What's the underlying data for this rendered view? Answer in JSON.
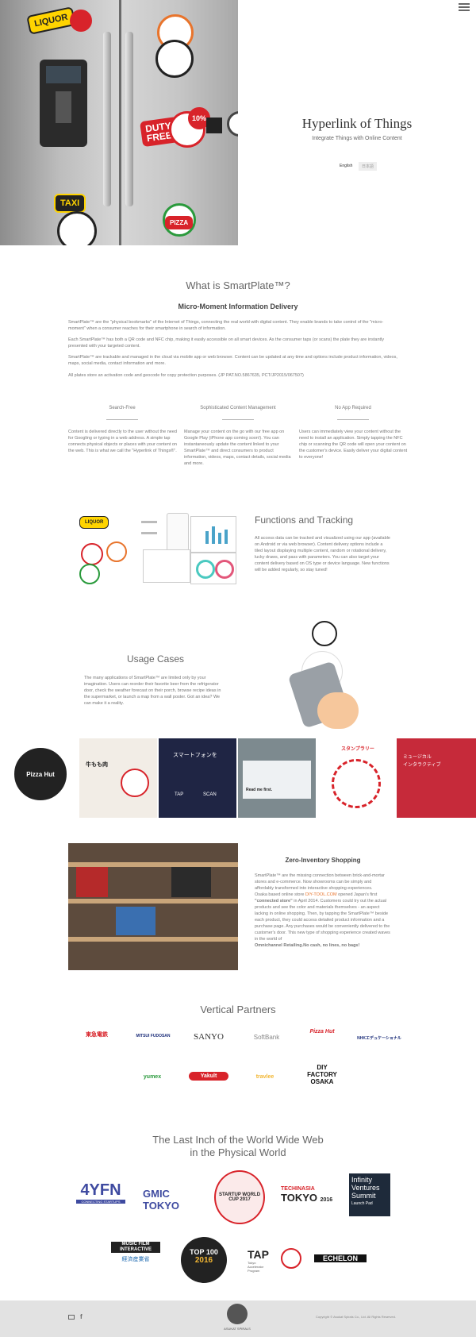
{
  "header": {
    "menu_icon": "hamburger-icon",
    "title": "Hyperlink of Things",
    "subtitle": "Integrate Things with Online Content",
    "lang_english": "English",
    "lang_japanese": "日本語"
  },
  "hero_stickers": {
    "liquor": "LIQUOR",
    "duty_free": "DUTY FREE",
    "percent": "10%",
    "taxi": "TAXI",
    "pizza": "PIZZA"
  },
  "about": {
    "heading": "What is SmartPlate™?",
    "subheading": "Micro-Moment Information Delivery",
    "paragraphs": [
      "SmartPlate™ are the \"physical bookmarks\" of the Internet of Things, connecting the real world with digital content. They enable brands to take control of the \"micro-moment\" when a consumer reaches for their smartphone in search of information.",
      "Each SmartPlate™ has both a QR code and NFC chip, making it easily accessible on all smart devices. As the consumer taps (or scans) the plate they are instantly presented with your targeted content.",
      "SmartPlate™ are trackable and managed in the cloud via mobile app or web browser. Content can be updated at any time and options include product information, videos, maps, social media, contact information and more.",
      "All plates store an activation code and geocode for copy protection purposes. (JP PAT.NO.5867635, PCT/JP2015/067507)"
    ]
  },
  "features": [
    {
      "title": "Search-Free",
      "text": "Content is delivered directly to the user without the need for Googling or typing in a web address. A simple tap connects physical objects or places with your content on the web. This is what we call the \"Hyperlink of Things®\"."
    },
    {
      "title": "Sophisticated Content Management",
      "text": "Manage your content on the go with our free app on Google Play (iPhone app coming soon!). You can instantaneously update the content linked to your SmartPlate™ and direct consumers to product information, videos, maps, contact details, social media and more."
    },
    {
      "title": "No App Required",
      "text": "Users can immediately view your content without the need to install an application. Simply tapping the NFC chip or scanning the QR code will open your content on the customer's device. Easily deliver your digital content to everyone!"
    }
  ],
  "functions": {
    "heading": "Functions and Tracking",
    "text": "All access data can be tracked and visualized using our app (available on Android or via web browser). Content delivery options include a tiled layout displaying multiple content, random or rotational delivery, lucky draws, and pass with parameters. You can also target your content delivery based on OS type or device language. New functions will be added regularly, so stay tuned!"
  },
  "usage": {
    "heading": "Usage Cases",
    "text": "The many applications of SmartPlate™ are limited only by your imagination. Users can reorder their favorite beer from the refrigerator door, check the weather forecast on their porch, browse recipe ideas in the supermarket, or launch a map from a wall poster. Got an idea? We can make it a reality."
  },
  "gallery": {
    "pizza_hut": "Pizza Hut",
    "gyudon": "牛もも肉",
    "smartphone_jp": "スマートフォンを",
    "tap": "TAP",
    "scan": "SCAN",
    "read_me": "Read me first.",
    "stamp_rally": "スタンプラリー",
    "interactive_jp": "インタラクティブ",
    "musical_jp": "ミュージカル"
  },
  "zero_inventory": {
    "heading": "Zero-Inventory Shopping",
    "text1": "SmartPlate™ are the missing connection between brick-and-mortar stores and e-commerce. Now showrooms can be simply and affordably transformed into interactive shopping experiences.",
    "text2_prefix": "Osaka based online store ",
    "diy_link": "DIY-TOOL.COM",
    "text2_mid": " opened Japan's first ",
    "connected_store": "\"connected store\"",
    "text2_suffix": " in April 2014. Customers could try out the actual products and see the color and materials themselves - an aspect lacking in online shopping. Then, by tapping the SmartPlate™ beside each product, they could access detailed product information and a purchase page. Any purchases would be conveniently delivered to the customer's door. This new type of shopping experience created waves in the world of",
    "omnichannel": "Omnichannel Retailing.No cash, no lines, no bags!"
  },
  "partners": {
    "heading": "Vertical Partners",
    "row1": [
      "東急電鉄",
      "MITSUI FUDOSAN",
      "SANYO",
      "SoftBank",
      "Pizza Hut",
      "NHKエデュケーショナル"
    ],
    "row2": [
      "yumex",
      "Yakult",
      "travlee",
      "DIY FACTORY OSAKA"
    ]
  },
  "events": {
    "heading_line1": "The Last Inch of the World Wide Web",
    "heading_line2": "in the Physical World",
    "row1": [
      "4YFN",
      "CONNECTING STARTUPS",
      "GMIC TOKYO",
      "STARTUP WORLD CUP 2017",
      "TECHINASIA",
      "TOKYO",
      "2016",
      "Infinity Ventures Summit",
      "Launch Pad"
    ],
    "row2": [
      "MUSIC FILM INTERACTIVE",
      "経済産業省",
      "TOP 100",
      "2016",
      "TAP",
      "Tokyo Accelerator Program",
      "ECHELON"
    ]
  },
  "footer": {
    "mail_icon": "mail-icon",
    "facebook_icon": "facebook-icon",
    "brand": "ASUKAT SPIRALS",
    "copyright": "Copyright © Asukat Spirals Co., Ltd. All Rights Reserved."
  },
  "colors": {
    "accent_red": "#d8232a",
    "dark": "#222222",
    "footer_bg": "#e2e2e2",
    "link_orange": "#e8742c"
  }
}
